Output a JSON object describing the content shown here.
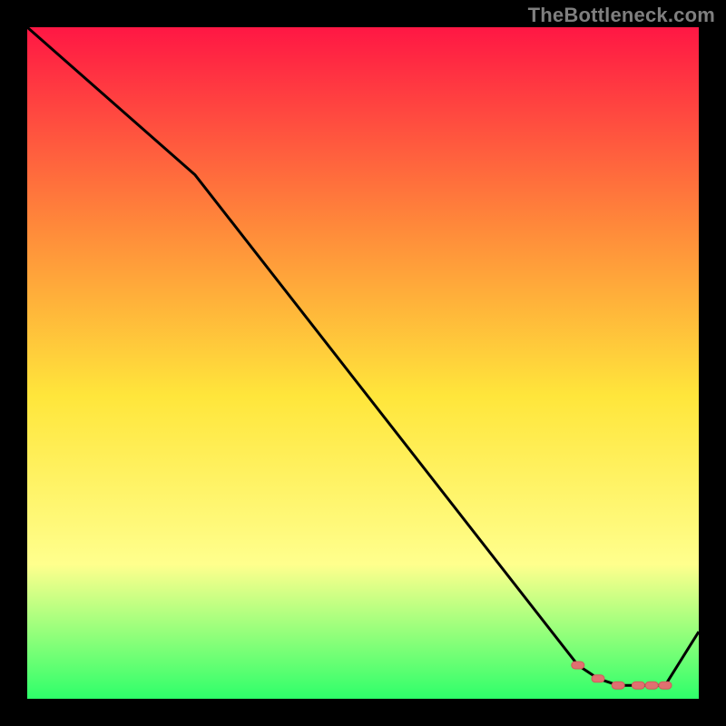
{
  "watermark": "TheBottleneck.com",
  "colors": {
    "background": "#000000",
    "gradient_top": "#ff1744",
    "gradient_mid_upper": "#ff8a3a",
    "gradient_mid": "#ffe63b",
    "gradient_lower": "#ffff8d",
    "gradient_bottom": "#2eff6a",
    "line": "#000000",
    "marker_fill": "#e07070",
    "marker_stroke": "#d05a5a"
  },
  "chart_data": {
    "type": "line",
    "title": "",
    "xlabel": "",
    "ylabel": "",
    "xlim": [
      0,
      100
    ],
    "ylim": [
      0,
      100
    ],
    "x": [
      0,
      25,
      82,
      85,
      88,
      91,
      93,
      95,
      100
    ],
    "y": [
      100,
      78,
      5,
      3,
      2,
      2,
      2,
      2,
      10
    ],
    "markers": {
      "x": [
        82,
        85,
        88,
        91,
        93,
        95
      ],
      "y": [
        5,
        3,
        2,
        2,
        2,
        2
      ]
    }
  }
}
